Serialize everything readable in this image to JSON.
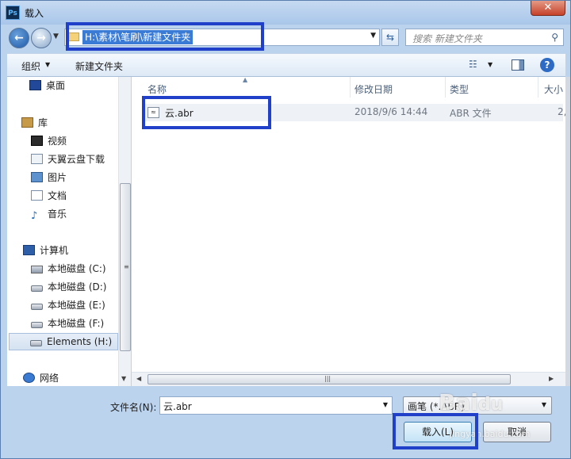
{
  "window": {
    "title": "载入",
    "app_icon": "Ps",
    "close": "✕"
  },
  "address": {
    "path": "H:\\素材\\笔刷\\新建文件夹"
  },
  "search": {
    "placeholder": "搜索 新建文件夹"
  },
  "toolbar": {
    "organize": "组织",
    "new_folder": "新建文件夹"
  },
  "sidebar": {
    "items": [
      {
        "label": "桌面",
        "icon": "desktop-icon"
      },
      {
        "label": "库",
        "icon": "library-icon"
      },
      {
        "label": "视频",
        "icon": "video-icon"
      },
      {
        "label": "天翼云盘下载",
        "icon": "download-folder-icon"
      },
      {
        "label": "图片",
        "icon": "pictures-icon"
      },
      {
        "label": "文档",
        "icon": "documents-icon"
      },
      {
        "label": "音乐",
        "icon": "music-icon"
      },
      {
        "label": "计算机",
        "icon": "computer-icon"
      },
      {
        "label": "本地磁盘 (C:)",
        "icon": "system-drive-icon"
      },
      {
        "label": "本地磁盘 (D:)",
        "icon": "drive-icon"
      },
      {
        "label": "本地磁盘 (E:)",
        "icon": "drive-icon"
      },
      {
        "label": "本地磁盘 (F:)",
        "icon": "drive-icon"
      },
      {
        "label": "Elements (H:)",
        "icon": "drive-icon",
        "selected": true
      },
      {
        "label": "网络",
        "icon": "network-icon"
      }
    ]
  },
  "file_list": {
    "columns": [
      "名称",
      "修改日期",
      "类型",
      "大小"
    ],
    "rows": [
      {
        "name": "云.abr",
        "modified": "2018/9/6 14:44",
        "type": "ABR 文件",
        "size": "2,"
      }
    ]
  },
  "footer": {
    "filename_label": "文件名(N):",
    "filename_value": "云.abr",
    "filetype_value": "画笔 (*.ABR)",
    "load_label": "载入(L)",
    "cancel_label": "取消"
  },
  "colors": {
    "highlight": "#2140c9",
    "accent": "#3a7bd5"
  }
}
